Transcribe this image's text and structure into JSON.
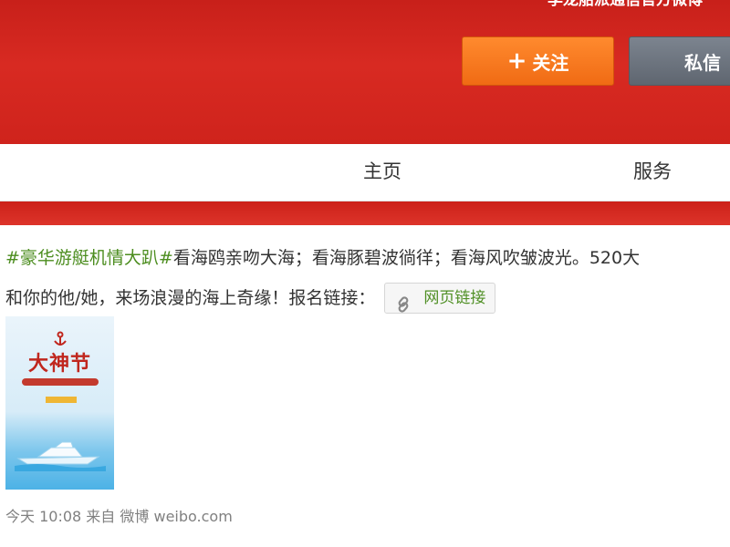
{
  "header": {
    "subtitle": "李龙船派通信官方微博",
    "follow_label": "关注",
    "message_label": "私信",
    "brand_color": "#d42a22"
  },
  "nav": {
    "tabs": [
      {
        "label": "主页"
      },
      {
        "label": "服务"
      }
    ]
  },
  "post": {
    "topic": "#豪华游艇机情大趴#",
    "line1_text": "看海鸥亲吻大海；看海豚碧波徜徉；看海风吹皱波光。520大",
    "line2_text": "和你的他/她，来场浪漫的海上奇缘！报名链接：",
    "link_label": "网页链接",
    "image_title": "大神节",
    "time": "今天 10:08",
    "source_prefix": "来自",
    "source": "微博 weibo.com"
  }
}
